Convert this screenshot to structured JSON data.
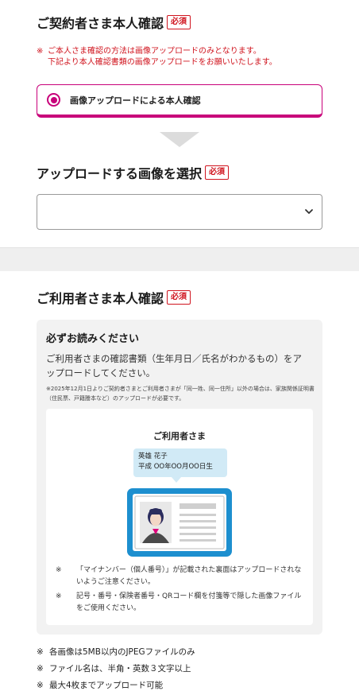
{
  "contractor": {
    "heading": "ご契約者さま本人確認",
    "required_badge": "必須",
    "notice_mark": "※",
    "notice_line1": "ご本人さま確認の方法は画像アップロードのみとなります。",
    "notice_line2": "下記より本人確認書類の画像アップロードをお願いいたします。",
    "method_label": "画像アップロードによる本人確認",
    "method_selected": true,
    "upload_heading": "アップロードする画像を選択",
    "upload_required_badge": "必須",
    "select_value": ""
  },
  "user": {
    "heading": "ご利用者さま本人確認",
    "required_badge": "必須",
    "read_title": "必ずお読みください",
    "read_desc": "ご利用者さまの確認書類（生年月日／氏名がわかるもの）をアップロードしてください。",
    "read_note": "※2025年12月1日よりご契約者さまとご利用者さまが「同一姓、同一住所」以外の場合は、家族関係証明書（住民票、戸籍謄本など）のアップロードが必要です。",
    "illustration": {
      "title": "ご利用者さま",
      "bubble_name": "英雄 花子",
      "bubble_birth": "平成 OO年OO月OO日生",
      "notes": [
        {
          "mark": "※",
          "text": "「マイナンバー（個人番号）」が記載された裏面はアップロードされないようご注意ください。"
        },
        {
          "mark": "※",
          "text": "記号・番号・保険者番号・QRコード欄を付箋等で隠した画像ファイルをご使用ください。"
        }
      ]
    },
    "footer_notes": [
      {
        "mark": "※",
        "text": "各画像は5MB以内のJPEGファイルのみ"
      },
      {
        "mark": "※",
        "text": "ファイル名は、半角・英数３文字以上"
      },
      {
        "mark": "※",
        "text": "最大4枚までアップロード可能"
      }
    ]
  },
  "colors": {
    "accent": "#c8007a",
    "required_red": "#d0141e",
    "card_blue": "#1d8fcf",
    "bubble_blue": "#d1eaf6",
    "panel_gray": "#f2f2f2"
  },
  "icons": {
    "radio": "radio-selected-icon",
    "select_chevron": "chevron-down-icon",
    "step_arrow": "triangle-down-icon",
    "id_card": "id-card-illustration"
  }
}
